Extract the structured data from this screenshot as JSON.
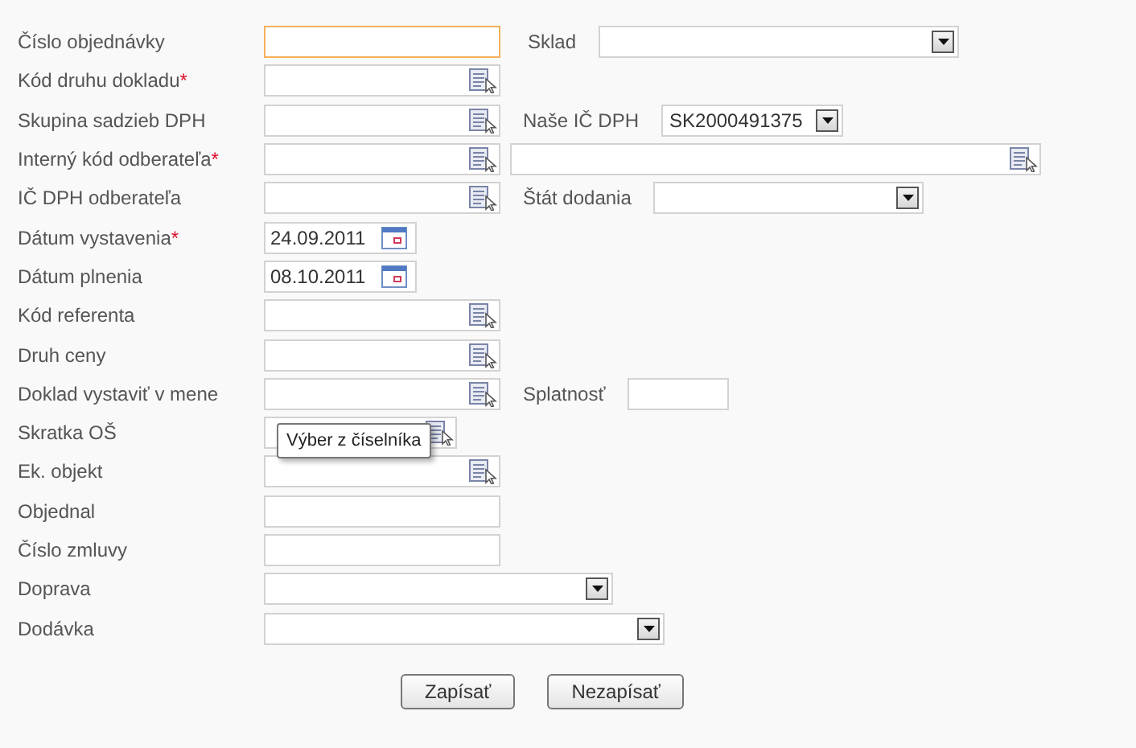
{
  "form": {
    "rows": [
      {
        "label": "Číslo objednávky",
        "field": {
          "kind": "text",
          "focused": true
        },
        "extra": {
          "label": "Sklad",
          "field": {
            "kind": "select"
          }
        }
      },
      {
        "label": "Kód druhu dokladu",
        "required_mark": "*",
        "field": {
          "kind": "lookup",
          "focused": false
        }
      },
      {
        "label": "Skupina sadzieb DPH",
        "field": {
          "kind": "lookup",
          "focused": false
        },
        "extra": {
          "label": "Naše IČ DPH",
          "field": {
            "kind": "select",
            "value": "SK2000491375"
          }
        }
      },
      {
        "label": "Interný kód odberateľa",
        "required_mark": "*",
        "field": {
          "kind": "lookup",
          "focused": false
        },
        "extra": {
          "field": {
            "kind": "lookup"
          }
        }
      },
      {
        "label": "IČ DPH odberateľa",
        "field": {
          "kind": "lookup",
          "focused": false
        },
        "extra": {
          "label": "Štát dodania",
          "field": {
            "kind": "select"
          }
        }
      },
      {
        "label": "Dátum vystavenia",
        "required_mark": "*",
        "field": {
          "kind": "date",
          "value": "24.09.2011",
          "focused": false
        }
      },
      {
        "label": "Dátum plnenia",
        "field": {
          "kind": "date",
          "value": "08.10.2011",
          "focused": false
        }
      },
      {
        "label": "Kód referenta",
        "field": {
          "kind": "lookup",
          "focused": false
        }
      },
      {
        "label": "Druh ceny",
        "field": {
          "kind": "lookup",
          "focused": false
        }
      },
      {
        "label": "Doklad vystaviť v mene",
        "field": {
          "kind": "lookup",
          "focused": false
        },
        "extra": {
          "label": "Splatnosť",
          "field": {
            "kind": "text"
          }
        }
      },
      {
        "label": "Skratka OŠ",
        "field": {
          "kind": "lookup",
          "focused": false
        },
        "tooltip": "Výber z číselníka"
      },
      {
        "label": "Ek. objekt",
        "field": {
          "kind": "lookup",
          "focused": false
        }
      },
      {
        "label": "Objednal",
        "field": {
          "kind": "text",
          "focused": false
        }
      },
      {
        "label": "Číslo zmluvy",
        "field": {
          "kind": "text",
          "focused": false
        }
      },
      {
        "label": "Doprava",
        "field": {
          "kind": "select",
          "focused": false
        }
      },
      {
        "label": "Dodávka",
        "field": {
          "kind": "select",
          "focused": false
        }
      }
    ]
  },
  "buttons": [
    "Zapísať",
    "Nezapísať"
  ]
}
